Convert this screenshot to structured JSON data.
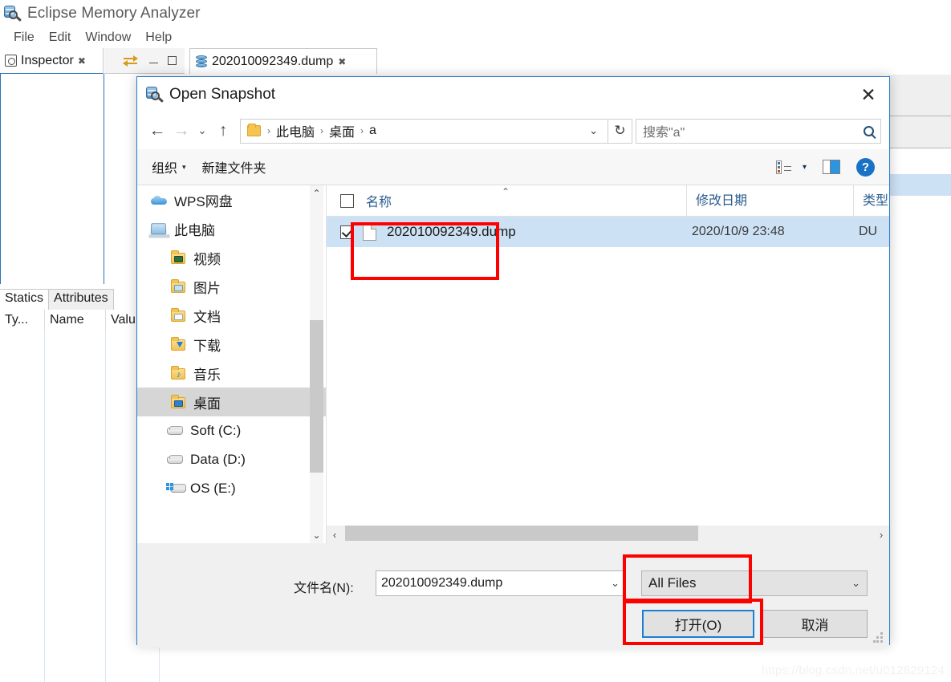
{
  "ide": {
    "title": "Eclipse Memory Analyzer",
    "app_icon": "memory-analyzer-icon",
    "menu": [
      "File",
      "Edit",
      "Window",
      "Help"
    ],
    "tabs": {
      "inspector": {
        "label": "Inspector",
        "icon": "inspector-icon",
        "close": "✖"
      },
      "dump": {
        "label": "202010092349.dump",
        "icon": "heap-dump-icon",
        "close": "✖"
      }
    },
    "view_actions": {
      "swap": "swap-icon",
      "minimize": "minimize-icon",
      "maximize": "maximize-icon"
    },
    "inspector_bottom_tabs": [
      {
        "label": "Statics",
        "active": true
      },
      {
        "label": "Attributes",
        "active": false
      }
    ],
    "inspector_columns": [
      "Ty...",
      "Name",
      "Valu"
    ]
  },
  "dialog": {
    "title": "Open Snapshot",
    "icon": "open-snapshot-icon",
    "close_label": "✕",
    "nav": {
      "back": "←",
      "forward": "→",
      "recent": "⌄",
      "up": "↑",
      "folder_icon": "folder-icon",
      "breadcrumbs": [
        "此电脑",
        "桌面",
        "a"
      ],
      "separator": "›",
      "dropdown_caret": "⌄",
      "refresh": "↻"
    },
    "search": {
      "placeholder": "搜索\"a\"",
      "icon": "search-icon"
    },
    "toolbar": {
      "organize": "组织",
      "organize_caret": "▾",
      "new_folder": "新建文件夹",
      "view_icon": "view-options-icon",
      "view_caret": "▾",
      "preview_icon": "preview-pane-icon",
      "help_icon": "help-icon",
      "help_glyph": "?"
    },
    "navpane": {
      "items": [
        {
          "label": "WPS网盘",
          "icon": "wps-cloud-icon",
          "indent": 0,
          "selected": false
        },
        {
          "label": "此电脑",
          "icon": "this-pc-icon",
          "indent": 0,
          "selected": false
        },
        {
          "label": "视频",
          "icon": "videos-folder-icon",
          "indent": 1,
          "selected": false
        },
        {
          "label": "图片",
          "icon": "pictures-folder-icon",
          "indent": 1,
          "selected": false
        },
        {
          "label": "文档",
          "icon": "documents-folder-icon",
          "indent": 1,
          "selected": false
        },
        {
          "label": "下载",
          "icon": "downloads-folder-icon",
          "indent": 1,
          "selected": false
        },
        {
          "label": "音乐",
          "icon": "music-folder-icon",
          "indent": 1,
          "selected": false
        },
        {
          "label": "桌面",
          "icon": "desktop-folder-icon",
          "indent": 1,
          "selected": true
        },
        {
          "label": "Soft (C:)",
          "icon": "drive-icon",
          "indent": 1,
          "selected": false
        },
        {
          "label": "Data (D:)",
          "icon": "drive-icon",
          "indent": 1,
          "selected": false
        },
        {
          "label": "OS (E:)",
          "icon": "windows-drive-icon",
          "indent": 1,
          "selected": false
        }
      ],
      "scroll_up": "⌃",
      "scroll_down": "⌄"
    },
    "filelist": {
      "columns": [
        "名称",
        "修改日期",
        "类型"
      ],
      "sort_indicator": "⌃",
      "rows": [
        {
          "name": "202010092349.dump",
          "modified": "2020/10/9 23:48",
          "type": "DU",
          "checked": true,
          "selected": true,
          "icon": "file-icon"
        }
      ],
      "hscroll_left": "‹",
      "hscroll_right": "›"
    },
    "bottom": {
      "filename_label": "文件名(N):",
      "filename_value": "202010092349.dump",
      "filename_caret": "⌄",
      "filter_value": "All Files",
      "filter_caret": "⌄",
      "open_button": "打开(O)",
      "cancel_button": "取消"
    }
  },
  "annotations": {
    "color": "#fd0000",
    "boxes": [
      "file-row-highlight",
      "filter-combo-highlight",
      "open-button-highlight"
    ]
  },
  "watermark": "https://blog.csdn.net/u012829124"
}
